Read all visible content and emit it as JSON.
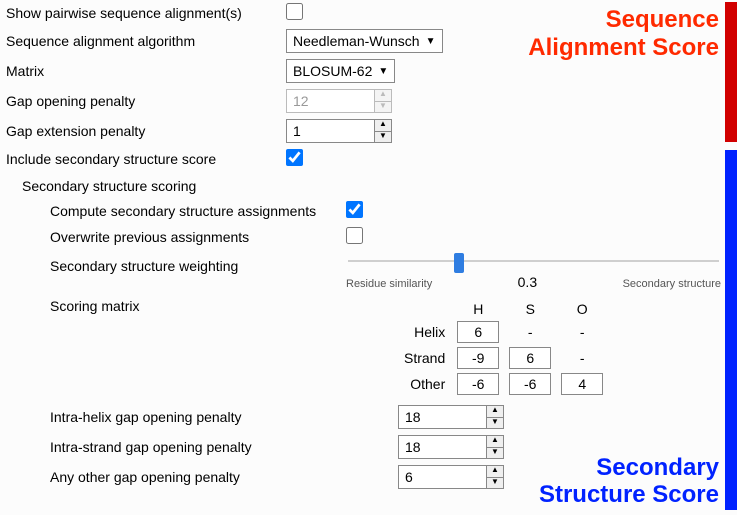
{
  "sequence_alignment": {
    "side_label": "Sequence\nAlignment Score",
    "show_pairwise_label": "Show pairwise sequence alignment(s)",
    "show_pairwise": false,
    "algorithm_label": "Sequence alignment algorithm",
    "algorithm_value": "Needleman-Wunsch",
    "matrix_label": "Matrix",
    "matrix_value": "BLOSUM-62",
    "gap_open_label": "Gap opening penalty",
    "gap_open_value": "12",
    "gap_open_enabled": false,
    "gap_ext_label": "Gap extension penalty",
    "gap_ext_value": "1"
  },
  "secondary": {
    "side_label": "Secondary\nStructure Score",
    "include_label": "Include secondary structure score",
    "include": true,
    "section_title": "Secondary structure scoring",
    "compute_label": "Compute secondary structure assignments",
    "compute": true,
    "overwrite_label": "Overwrite previous assignments",
    "overwrite": false,
    "weighting_label": "Secondary structure weighting",
    "weighting": {
      "percent": 30,
      "left_caption": "Residue similarity",
      "value_text": "0.3",
      "right_caption": "Secondary structure"
    },
    "scoring_matrix_label": "Scoring matrix",
    "matrix": {
      "col_headers": [
        "H",
        "S",
        "O"
      ],
      "row_headers": [
        "Helix",
        "Strand",
        "Other"
      ],
      "cells": {
        "HH": "6",
        "HS": "-",
        "HO": "-",
        "SH": "-9",
        "SS": "6",
        "SO": "-",
        "OH": "-6",
        "OS": "-6",
        "OO": "4"
      }
    },
    "intra_helix_label": "Intra-helix gap opening penalty",
    "intra_helix_value": "18",
    "intra_strand_label": "Intra-strand gap opening penalty",
    "intra_strand_value": "18",
    "other_gap_label": "Any other gap opening penalty",
    "other_gap_value": "6"
  }
}
